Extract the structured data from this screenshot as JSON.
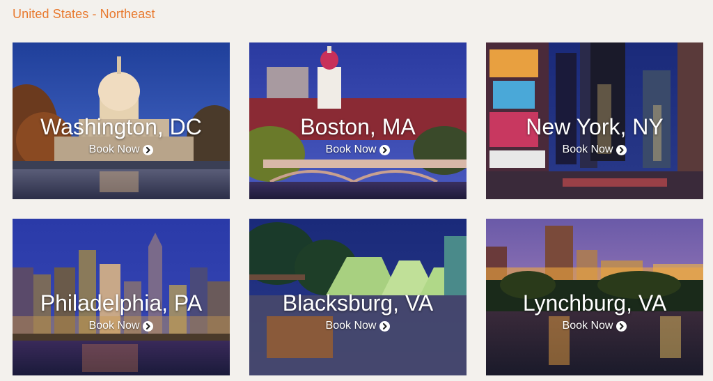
{
  "region": {
    "title": "United States - Northeast"
  },
  "cards": [
    {
      "city": "Washington, DC",
      "cta": "Book Now"
    },
    {
      "city": "Boston, MA",
      "cta": "Book Now"
    },
    {
      "city": "New York, NY",
      "cta": "Book Now"
    },
    {
      "city": "Philadelphia, PA",
      "cta": "Book Now"
    },
    {
      "city": "Blacksburg, VA",
      "cta": "Book Now"
    },
    {
      "city": "Lynchburg, VA",
      "cta": "Book Now"
    }
  ],
  "icons": {
    "cta_icon": "chevron-right-circle-icon"
  },
  "colors": {
    "accent": "#e8792e",
    "background": "#f3f1ed",
    "card_text": "#ffffff"
  }
}
